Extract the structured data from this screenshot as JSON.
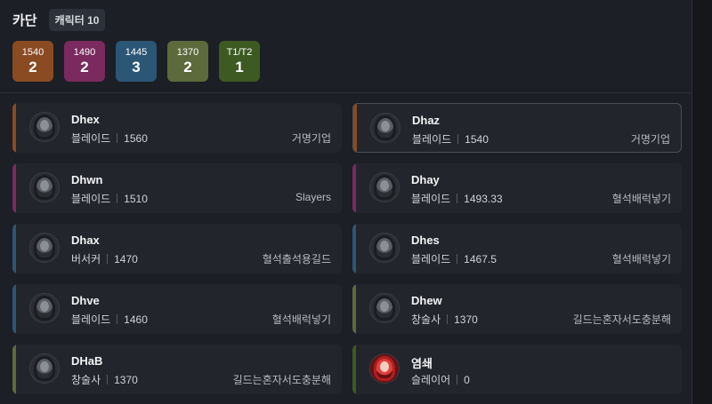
{
  "header": {
    "title": "카단",
    "count": "캐릭터 10"
  },
  "tiers": [
    {
      "label": "1540",
      "count": "2",
      "color": "#8a4a22"
    },
    {
      "label": "1490",
      "count": "2",
      "color": "#7a2a5e"
    },
    {
      "label": "1445",
      "count": "3",
      "color": "#2c5675"
    },
    {
      "label": "1370",
      "count": "2",
      "color": "#5c6a3c"
    },
    {
      "label": "T1/T2",
      "count": "1",
      "color": "#3c5a22"
    }
  ],
  "characters": [
    {
      "name": "Dhex",
      "class": "블레이드",
      "level": "1560",
      "guild": "거명기업",
      "accent": "#8a4a22",
      "selected": false,
      "avatar": "hooded-icon"
    },
    {
      "name": "Dhaz",
      "class": "블레이드",
      "level": "1540",
      "guild": "거명기업",
      "accent": "#8a4a22",
      "selected": true,
      "avatar": "hooded-icon"
    },
    {
      "name": "Dhwn",
      "class": "블레이드",
      "level": "1510",
      "guild": "Slayers",
      "accent": "#7a2a5e",
      "selected": false,
      "avatar": "hooded-icon"
    },
    {
      "name": "Dhay",
      "class": "블레이드",
      "level": "1493.33",
      "guild": "혈석배럭넣기",
      "accent": "#7a2a5e",
      "selected": false,
      "avatar": "hooded-icon"
    },
    {
      "name": "Dhax",
      "class": "버서커",
      "level": "1470",
      "guild": "혈석출석용길드",
      "accent": "#2c5675",
      "selected": false,
      "avatar": "berserker-icon"
    },
    {
      "name": "Dhes",
      "class": "블레이드",
      "level": "1467.5",
      "guild": "혈석배럭넣기",
      "accent": "#2c5675",
      "selected": false,
      "avatar": "hooded-icon"
    },
    {
      "name": "Dhve",
      "class": "블레이드",
      "level": "1460",
      "guild": "혈석배럭넣기",
      "accent": "#2c5675",
      "selected": false,
      "avatar": "hooded-icon"
    },
    {
      "name": "Dhew",
      "class": "창술사",
      "level": "1370",
      "guild": "길드는혼자서도충분해",
      "accent": "#5c6a3c",
      "selected": false,
      "avatar": "lancer-icon"
    },
    {
      "name": "DHaB",
      "class": "창술사",
      "level": "1370",
      "guild": "길드는혼자서도충분해",
      "accent": "#5c6a3c",
      "selected": false,
      "avatar": "lancer-icon"
    },
    {
      "name": "염쇄",
      "class": "슬레이어",
      "level": "0",
      "guild": "",
      "accent": "#3c5a22",
      "selected": false,
      "avatar": "slayer-icon"
    }
  ]
}
